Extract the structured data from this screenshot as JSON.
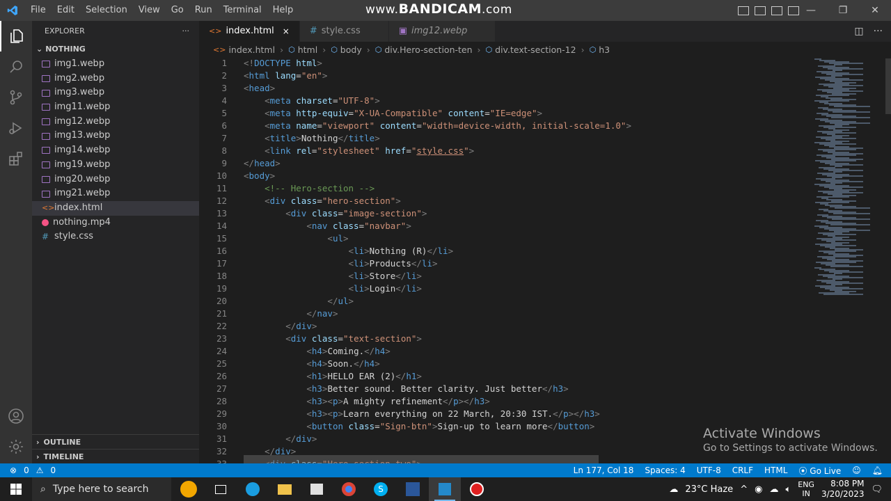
{
  "menu": [
    "File",
    "Edit",
    "Selection",
    "View",
    "Go",
    "Run",
    "Terminal",
    "Help"
  ],
  "watermark": {
    "prefix": "www.",
    "brand": "BANDICAM",
    "suffix": ".com"
  },
  "explorer": {
    "title": "EXPLORER",
    "more": "···",
    "folder": "NOTHING",
    "files": [
      {
        "name": "img1.webp",
        "type": "img"
      },
      {
        "name": "img2.webp",
        "type": "img"
      },
      {
        "name": "img3.webp",
        "type": "img"
      },
      {
        "name": "img11.webp",
        "type": "img"
      },
      {
        "name": "img12.webp",
        "type": "img"
      },
      {
        "name": "img13.webp",
        "type": "img"
      },
      {
        "name": "img14.webp",
        "type": "img"
      },
      {
        "name": "img19.webp",
        "type": "img"
      },
      {
        "name": "img20.webp",
        "type": "img"
      },
      {
        "name": "img21.webp",
        "type": "img"
      },
      {
        "name": "index.html",
        "type": "html",
        "selected": true
      },
      {
        "name": "nothing.mp4",
        "type": "mp4"
      },
      {
        "name": "style.css",
        "type": "css"
      }
    ],
    "outline": "OUTLINE",
    "timeline": "TIMELINE"
  },
  "tabs": [
    {
      "label": "index.html",
      "icon": "<>",
      "active": true,
      "close": "×"
    },
    {
      "label": "style.css",
      "icon": "#",
      "active": false
    },
    {
      "label": "img12.webp",
      "icon": "▣",
      "active": false,
      "preview": true
    }
  ],
  "breadcrumb": [
    "index.html",
    "html",
    "body",
    "div.Hero-section-ten",
    "div.text-section-12",
    "h3"
  ],
  "code": [
    [
      [
        "br",
        "<!"
      ],
      [
        "tag",
        "DOCTYPE"
      ],
      [
        "txt",
        " "
      ],
      [
        "attr",
        "html"
      ],
      [
        "br",
        ">"
      ]
    ],
    [
      [
        "br",
        "<"
      ],
      [
        "tag",
        "html"
      ],
      [
        "txt",
        " "
      ],
      [
        "attr",
        "lang"
      ],
      [
        "txt",
        "="
      ],
      [
        "str",
        "\"en\""
      ],
      [
        "br",
        ">"
      ]
    ],
    [
      [
        "br",
        "<"
      ],
      [
        "tag",
        "head"
      ],
      [
        "br",
        ">"
      ]
    ],
    [
      [
        "txt",
        "    "
      ],
      [
        "br",
        "<"
      ],
      [
        "tag",
        "meta"
      ],
      [
        "txt",
        " "
      ],
      [
        "attr",
        "charset"
      ],
      [
        "txt",
        "="
      ],
      [
        "str",
        "\"UTF-8\""
      ],
      [
        "br",
        ">"
      ]
    ],
    [
      [
        "txt",
        "    "
      ],
      [
        "br",
        "<"
      ],
      [
        "tag",
        "meta"
      ],
      [
        "txt",
        " "
      ],
      [
        "attr",
        "http-equiv"
      ],
      [
        "txt",
        "="
      ],
      [
        "str",
        "\"X-UA-Compatible\""
      ],
      [
        "txt",
        " "
      ],
      [
        "attr",
        "content"
      ],
      [
        "txt",
        "="
      ],
      [
        "str",
        "\"IE=edge\""
      ],
      [
        "br",
        ">"
      ]
    ],
    [
      [
        "txt",
        "    "
      ],
      [
        "br",
        "<"
      ],
      [
        "tag",
        "meta"
      ],
      [
        "txt",
        " "
      ],
      [
        "attr",
        "name"
      ],
      [
        "txt",
        "="
      ],
      [
        "str",
        "\"viewport\""
      ],
      [
        "txt",
        " "
      ],
      [
        "attr",
        "content"
      ],
      [
        "txt",
        "="
      ],
      [
        "str",
        "\"width=device-width, initial-scale=1.0\""
      ],
      [
        "br",
        ">"
      ]
    ],
    [
      [
        "txt",
        "    "
      ],
      [
        "br",
        "<"
      ],
      [
        "tag",
        "title"
      ],
      [
        "br",
        ">"
      ],
      [
        "txt",
        "Nothing"
      ],
      [
        "br",
        "</"
      ],
      [
        "tag",
        "title"
      ],
      [
        "br",
        ">"
      ]
    ],
    [
      [
        "txt",
        "    "
      ],
      [
        "br",
        "<"
      ],
      [
        "tag",
        "link"
      ],
      [
        "txt",
        " "
      ],
      [
        "attr",
        "rel"
      ],
      [
        "txt",
        "="
      ],
      [
        "str",
        "\"stylesheet\""
      ],
      [
        "txt",
        " "
      ],
      [
        "attr",
        "href"
      ],
      [
        "txt",
        "="
      ],
      [
        "str",
        "\""
      ],
      [
        "link",
        "style.css"
      ],
      [
        "str",
        "\""
      ],
      [
        "br",
        ">"
      ]
    ],
    [
      [
        "br",
        "</"
      ],
      [
        "tag",
        "head"
      ],
      [
        "br",
        ">"
      ]
    ],
    [
      [
        "br",
        "<"
      ],
      [
        "tag",
        "body"
      ],
      [
        "br",
        ">"
      ]
    ],
    [
      [
        "txt",
        "    "
      ],
      [
        "com",
        "<!-- Hero-section -->"
      ]
    ],
    [
      [
        "txt",
        "    "
      ],
      [
        "br",
        "<"
      ],
      [
        "tag",
        "div"
      ],
      [
        "txt",
        " "
      ],
      [
        "attr",
        "class"
      ],
      [
        "txt",
        "="
      ],
      [
        "str",
        "\"hero-section\""
      ],
      [
        "br",
        ">"
      ]
    ],
    [
      [
        "txt",
        "        "
      ],
      [
        "br",
        "<"
      ],
      [
        "tag",
        "div"
      ],
      [
        "txt",
        " "
      ],
      [
        "attr",
        "class"
      ],
      [
        "txt",
        "="
      ],
      [
        "str",
        "\"image-section\""
      ],
      [
        "br",
        ">"
      ]
    ],
    [
      [
        "txt",
        "            "
      ],
      [
        "br",
        "<"
      ],
      [
        "tag",
        "nav"
      ],
      [
        "txt",
        " "
      ],
      [
        "attr",
        "class"
      ],
      [
        "txt",
        "="
      ],
      [
        "str",
        "\"navbar\""
      ],
      [
        "br",
        ">"
      ]
    ],
    [
      [
        "txt",
        "                "
      ],
      [
        "br",
        "<"
      ],
      [
        "tag",
        "ul"
      ],
      [
        "br",
        ">"
      ]
    ],
    [
      [
        "txt",
        "                    "
      ],
      [
        "br",
        "<"
      ],
      [
        "tag",
        "li"
      ],
      [
        "br",
        ">"
      ],
      [
        "txt",
        "Nothing (R)"
      ],
      [
        "br",
        "</"
      ],
      [
        "tag",
        "li"
      ],
      [
        "br",
        ">"
      ]
    ],
    [
      [
        "txt",
        "                    "
      ],
      [
        "br",
        "<"
      ],
      [
        "tag",
        "li"
      ],
      [
        "br",
        ">"
      ],
      [
        "txt",
        "Products"
      ],
      [
        "br",
        "</"
      ],
      [
        "tag",
        "li"
      ],
      [
        "br",
        ">"
      ]
    ],
    [
      [
        "txt",
        "                    "
      ],
      [
        "br",
        "<"
      ],
      [
        "tag",
        "li"
      ],
      [
        "br",
        ">"
      ],
      [
        "txt",
        "Store"
      ],
      [
        "br",
        "</"
      ],
      [
        "tag",
        "li"
      ],
      [
        "br",
        ">"
      ]
    ],
    [
      [
        "txt",
        "                    "
      ],
      [
        "br",
        "<"
      ],
      [
        "tag",
        "li"
      ],
      [
        "br",
        ">"
      ],
      [
        "txt",
        "Login"
      ],
      [
        "br",
        "</"
      ],
      [
        "tag",
        "li"
      ],
      [
        "br",
        ">"
      ]
    ],
    [
      [
        "txt",
        "                "
      ],
      [
        "br",
        "</"
      ],
      [
        "tag",
        "ul"
      ],
      [
        "br",
        ">"
      ]
    ],
    [
      [
        "txt",
        "            "
      ],
      [
        "br",
        "</"
      ],
      [
        "tag",
        "nav"
      ],
      [
        "br",
        ">"
      ]
    ],
    [
      [
        "txt",
        "        "
      ],
      [
        "br",
        "</"
      ],
      [
        "tag",
        "div"
      ],
      [
        "br",
        ">"
      ]
    ],
    [
      [
        "txt",
        "        "
      ],
      [
        "br",
        "<"
      ],
      [
        "tag",
        "div"
      ],
      [
        "txt",
        " "
      ],
      [
        "attr",
        "class"
      ],
      [
        "txt",
        "="
      ],
      [
        "str",
        "\"text-section\""
      ],
      [
        "br",
        ">"
      ]
    ],
    [
      [
        "txt",
        "            "
      ],
      [
        "br",
        "<"
      ],
      [
        "tag",
        "h4"
      ],
      [
        "br",
        ">"
      ],
      [
        "txt",
        "Coming."
      ],
      [
        "br",
        "</"
      ],
      [
        "tag",
        "h4"
      ],
      [
        "br",
        ">"
      ]
    ],
    [
      [
        "txt",
        "            "
      ],
      [
        "br",
        "<"
      ],
      [
        "tag",
        "h4"
      ],
      [
        "br",
        ">"
      ],
      [
        "txt",
        "Soon."
      ],
      [
        "br",
        "</"
      ],
      [
        "tag",
        "h4"
      ],
      [
        "br",
        ">"
      ]
    ],
    [
      [
        "txt",
        "            "
      ],
      [
        "br",
        "<"
      ],
      [
        "tag",
        "h1"
      ],
      [
        "br",
        ">"
      ],
      [
        "txt",
        "HELLO EAR (2)"
      ],
      [
        "br",
        "</"
      ],
      [
        "tag",
        "h1"
      ],
      [
        "br",
        ">"
      ]
    ],
    [
      [
        "txt",
        "            "
      ],
      [
        "br",
        "<"
      ],
      [
        "tag",
        "h3"
      ],
      [
        "br",
        ">"
      ],
      [
        "txt",
        "Better sound. Better clarity. Just better"
      ],
      [
        "br",
        "</"
      ],
      [
        "tag",
        "h3"
      ],
      [
        "br",
        ">"
      ]
    ],
    [
      [
        "txt",
        "            "
      ],
      [
        "br",
        "<"
      ],
      [
        "tag",
        "h3"
      ],
      [
        "br",
        "><"
      ],
      [
        "tag",
        "p"
      ],
      [
        "br",
        ">"
      ],
      [
        "txt",
        "A mighty refinement"
      ],
      [
        "br",
        "</"
      ],
      [
        "tag",
        "p"
      ],
      [
        "br",
        "></"
      ],
      [
        "tag",
        "h3"
      ],
      [
        "br",
        ">"
      ]
    ],
    [
      [
        "txt",
        "            "
      ],
      [
        "br",
        "<"
      ],
      [
        "tag",
        "h3"
      ],
      [
        "br",
        "><"
      ],
      [
        "tag",
        "p"
      ],
      [
        "br",
        ">"
      ],
      [
        "txt",
        "Learn everything on 22 March, 20:30 IST."
      ],
      [
        "br",
        "</"
      ],
      [
        "tag",
        "p"
      ],
      [
        "br",
        "></"
      ],
      [
        "tag",
        "h3"
      ],
      [
        "br",
        ">"
      ]
    ],
    [
      [
        "txt",
        "            "
      ],
      [
        "br",
        "<"
      ],
      [
        "tag",
        "button"
      ],
      [
        "txt",
        " "
      ],
      [
        "attr",
        "class"
      ],
      [
        "txt",
        "="
      ],
      [
        "str",
        "\"Sign-btn\""
      ],
      [
        "br",
        ">"
      ],
      [
        "txt",
        "Sign-up to learn more"
      ],
      [
        "br",
        "</"
      ],
      [
        "tag",
        "button"
      ],
      [
        "br",
        ">"
      ]
    ],
    [
      [
        "txt",
        "        "
      ],
      [
        "br",
        "</"
      ],
      [
        "tag",
        "div"
      ],
      [
        "br",
        ">"
      ]
    ],
    [
      [
        "txt",
        "    "
      ],
      [
        "br",
        "</"
      ],
      [
        "tag",
        "div"
      ],
      [
        "br",
        ">"
      ]
    ],
    [
      [
        "txt",
        "    "
      ],
      [
        "br",
        "<"
      ],
      [
        "tag",
        "div"
      ],
      [
        "txt",
        " "
      ],
      [
        "attr",
        "class"
      ],
      [
        "txt",
        "="
      ],
      [
        "str",
        "\"Hero-section-two\""
      ],
      [
        "br",
        ">"
      ]
    ]
  ],
  "activate": {
    "title": "Activate Windows",
    "subtitle": "Go to Settings to activate Windows."
  },
  "status": {
    "errors": "0",
    "warnings": "0",
    "position": "Ln 177, Col 18",
    "spaces": "Spaces: 4",
    "encoding": "UTF-8",
    "eol": "CRLF",
    "language": "HTML",
    "golive": "Go Live"
  },
  "taskbar": {
    "search_placeholder": "Type here to search",
    "weather": "23°C  Haze",
    "lang1": "ENG",
    "lang2": "IN",
    "time": "8:08 PM",
    "date": "3/20/2023"
  }
}
